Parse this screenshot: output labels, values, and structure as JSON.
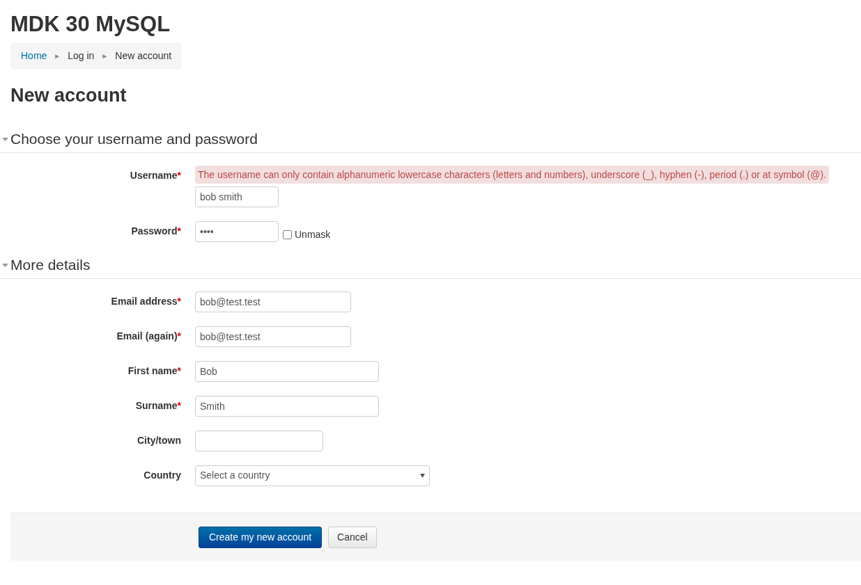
{
  "site_title": "MDK 30 MySQL",
  "breadcrumb": [
    {
      "label": "Home",
      "link": true
    },
    {
      "separator": "►",
      "label": "Log in",
      "link": false
    },
    {
      "separator": "►",
      "label": "New account",
      "link": false
    }
  ],
  "page_heading": "New account",
  "sections": [
    {
      "title": "Choose your username and password",
      "expanded": true,
      "fields": [
        {
          "kind": "text",
          "label": "Username",
          "required_mark": "*",
          "error": "The username can only contain alphanumeric lowercase characters (letters and numbers), underscore (_), hyphen (-), period (.) or at symbol (@).",
          "value": "bob smith"
        },
        {
          "kind": "password",
          "label": "Password",
          "required_mark": "*",
          "value": "••••",
          "unmask": {
            "label": "Unmask",
            "checked": false
          }
        }
      ]
    },
    {
      "title": "More details",
      "expanded": true,
      "fields": [
        {
          "kind": "text",
          "label": "Email address",
          "required_mark": "*",
          "value": "bob@test.test"
        },
        {
          "kind": "text",
          "label": "Email (again)",
          "required_mark": "*",
          "value": "bob@test.test"
        },
        {
          "kind": "text",
          "label": "First name",
          "required_mark": "*",
          "value": "Bob"
        },
        {
          "kind": "text",
          "label": "Surname",
          "required_mark": "*",
          "value": "Smith"
        },
        {
          "kind": "text",
          "label": "City/town"
        },
        {
          "kind": "select",
          "label": "Country",
          "value": "Select a country"
        }
      ]
    }
  ],
  "buttons": [
    {
      "label": "Create my new account",
      "kind": "primary"
    },
    {
      "label": "Cancel",
      "kind": "secondary"
    }
  ]
}
